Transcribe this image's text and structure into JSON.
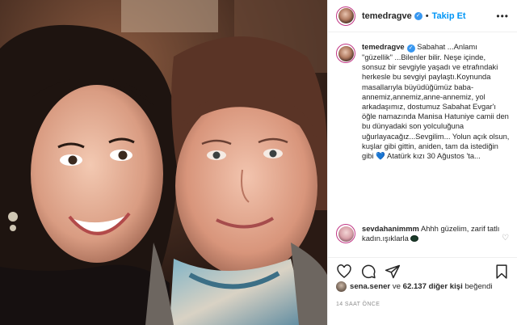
{
  "post": {
    "username": "temedragve",
    "follow_label": "Takip Et",
    "separator": "•",
    "more_label": "•••"
  },
  "caption": {
    "username": "temedragve",
    "text": "Sabahat ...Anlamı \"güzellik\" ...Bilenler bilir. Neşe içinde, sonsuz bir sevgiyle yaşadı ve etrafındaki herkesle bu sevgiyi paylaştı.Koynunda masallarıyla büyüdüğümüz baba-annemiz,annemiz,anne-annemiz, yol arkadaşımız, dostumuz Sabahat Evgar'ı öğle namazında Manisa Hatuniye camii den bu dünyadaki son yolculuğuna uğurlayacağız...Sevgilim... Yolun açık olsun, kuşlar gibi gittin, aniden, tam da istediğin gibi 💙 Atatürk kızı 30 Ağustos 'ta..."
  },
  "comment": {
    "username": "sevdahanimmm",
    "text": "Ahhh güzelim, zarif tatlı kadın.ışıklarla"
  },
  "likes": {
    "user": "sena.sener",
    "connector": "ve",
    "count_text": "62.137 diğer kişi",
    "suffix": "beğendi"
  },
  "timestamp": "14 SAAT ÖNCE",
  "icons": {
    "like": "heart-icon",
    "comment": "comment-bubble-icon",
    "share": "paper-plane-icon",
    "save": "bookmark-icon",
    "comment_like": "small-heart-icon",
    "options": "more-dots-icon"
  },
  "colors": {
    "follow_blue": "#0095f6",
    "verified_blue": "#3897f0",
    "text": "#262626",
    "muted": "#8e8e8e",
    "divider": "#efefef"
  }
}
